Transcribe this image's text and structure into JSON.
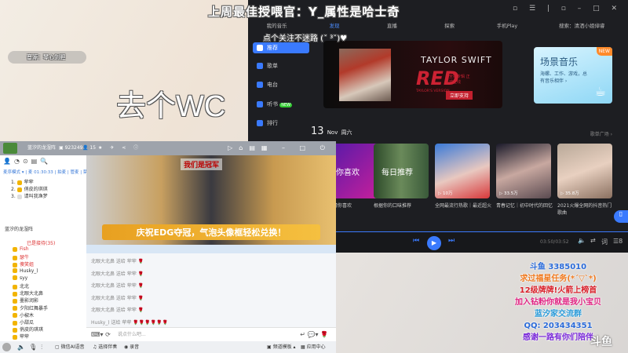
{
  "overlay": {
    "source": "音源：琴心剑胆",
    "wc": "去个WC",
    "title": "上周最佳授喂官：Y_属性是哈士奇",
    "follow": "点个关注不迷路 (ˇ ³ˇ)♥"
  },
  "music": {
    "tabs": [
      "我的音乐",
      "发现",
      "直播",
      "探索",
      "手机Play",
      "搜索：清洒小姐倬睿"
    ],
    "active_tab": "发现",
    "sidebar": [
      "推荐",
      "歌单",
      "电台",
      "听书",
      "排行"
    ],
    "sidebar_badge": "NEW",
    "banner": {
      "artist": "TAYLOR SWIFT",
      "album": "RED",
      "sub": "TAYLOR'S VERSION",
      "promo": "全新专辑 正式上线",
      "button": "立即支持"
    },
    "scene": {
      "title": "场景音乐",
      "desc": "海螺、工作、游戏，总有音乐相伴 ›",
      "badge": "NEW"
    },
    "date": {
      "day": "13",
      "month": "Nov",
      "weekday": "周六"
    },
    "more": "歌单广场 ›",
    "cards": [
      {
        "title": "你喜欢",
        "caption": "猜你喜欢",
        "plays": ""
      },
      {
        "title": "每日推荐",
        "caption": "根据你的口味推荐",
        "plays": ""
      },
      {
        "title": "",
        "caption": "全网最流行热歌｜最近超火",
        "plays": "▷ 10万"
      },
      {
        "title": "",
        "caption": "青春记忆｜初中时代的回忆",
        "plays": "▷ 33.5万"
      },
      {
        "title": "",
        "caption": "2021火爆全网的抖音热门歌曲",
        "plays": "▷ 35.8万"
      }
    ],
    "player": {
      "time": "03:50/03:52",
      "lyrics": "词",
      "queue": "8"
    }
  },
  "chat": {
    "header": {
      "channel": "蓝汐的龙湿阵",
      "room": "923249",
      "users": "15"
    },
    "mode": "麦序模式 ▾ | 麦 01:30:33 | 拍麦 | 管麦 | 禁麦",
    "queue": [
      {
        "n": "1.",
        "name": "荦荦"
      },
      {
        "n": "2.",
        "name": "俏皮的琪琪"
      },
      {
        "n": "3.",
        "name": "请叫我渔梦"
      }
    ],
    "channel_tree": "蓝汐的龙湿阵",
    "group": "已是接待(35)",
    "users": [
      "Fish",
      "瑟牛",
      "傻笑姐",
      "Husky_)",
      "syy",
      "北北",
      "北眼大北鼻",
      "墨影润影",
      "夕阳红舞暴手",
      "小椒木",
      "小甜瓜",
      "俏皮的琪琪",
      "荦荦"
    ],
    "banner": {
      "top": "我们是冠军",
      "slogan": "庆祝EDG夺冠，气泡头像框轻松兑换！"
    },
    "messages": [
      "北眼大北鼻 送给 荦荦 🌹",
      "北眼大北鼻 送给 荦荦 🌹",
      "北眼大北鼻 送给 荦荦 🌹",
      "北眼大北鼻 送给 荦荦 🌹",
      "北眼大北鼻 送给 荦荦 🌹",
      "Husky_) 送给 荦荦 🌹🌹🌹🌹🌹🌹"
    ],
    "input_placeholder": "说点什么吧...",
    "bottom": {
      "ai": "微信AI语音",
      "music": "选择伴奏",
      "record": "录音",
      "mode": "频道模板 ▴",
      "app": "应用中心"
    }
  },
  "promo": [
    "斗鱼  3385010",
    "求过福星任务(*ˊ▽ˋ*)",
    "12级牌牌!火箭上榜首",
    "加入钻粉你就是我小宝贝",
    "蓝汐家交流群",
    "QQ: 203434351",
    "感谢一路有你们陪伴"
  ],
  "logo": "斗鱼"
}
